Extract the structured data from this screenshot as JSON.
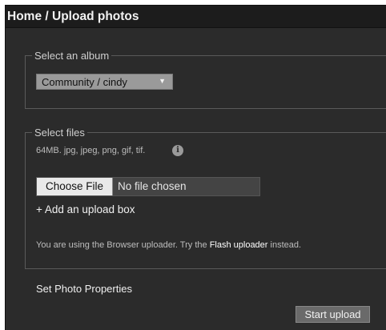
{
  "header": {
    "breadcrumb_home": "Home",
    "breadcrumb_separator": "/",
    "breadcrumb_current": "Upload photos"
  },
  "album_section": {
    "legend": "Select an album",
    "selected_album": "Community / cindy",
    "dropdown_icon": "triangle-down-icon"
  },
  "files_section": {
    "legend": "Select files",
    "allowed_types": "64MB. jpg, jpeg, png, gif, tif.",
    "info_icon": "info-icon",
    "choose_file_label": "Choose File",
    "no_file_text": "No file chosen",
    "add_upload_box": "+ Add an upload box",
    "uploader_note_prefix": "You are using the Browser uploader. Try the",
    "flash_uploader_link": "Flash uploader",
    "uploader_note_suffix": "instead."
  },
  "properties": {
    "label": "Set Photo Properties"
  },
  "actions": {
    "start_upload": "Start upload"
  },
  "colors": {
    "panel_bg": "#2b2b2b",
    "header_bg": "#1c1c1c",
    "select_bg": "#9a9a9a",
    "button_bg": "#6a6a6a"
  }
}
